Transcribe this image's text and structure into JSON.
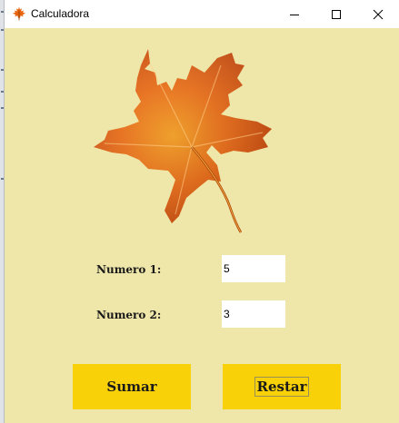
{
  "window": {
    "title": "Calculadora",
    "icon": "maple-leaf-icon",
    "controls": [
      "minimize-icon",
      "maximize-icon",
      "close-icon"
    ]
  },
  "colors": {
    "background": "#efe6a9",
    "button": "#f9d108",
    "leaf": "#e8650e"
  },
  "form": {
    "numero1_label": "Numero 1:",
    "numero1_value": "5",
    "numero2_label": "Numero 2:",
    "numero2_value": "3"
  },
  "buttons": {
    "sumar": "Sumar",
    "restar": "Restar"
  }
}
